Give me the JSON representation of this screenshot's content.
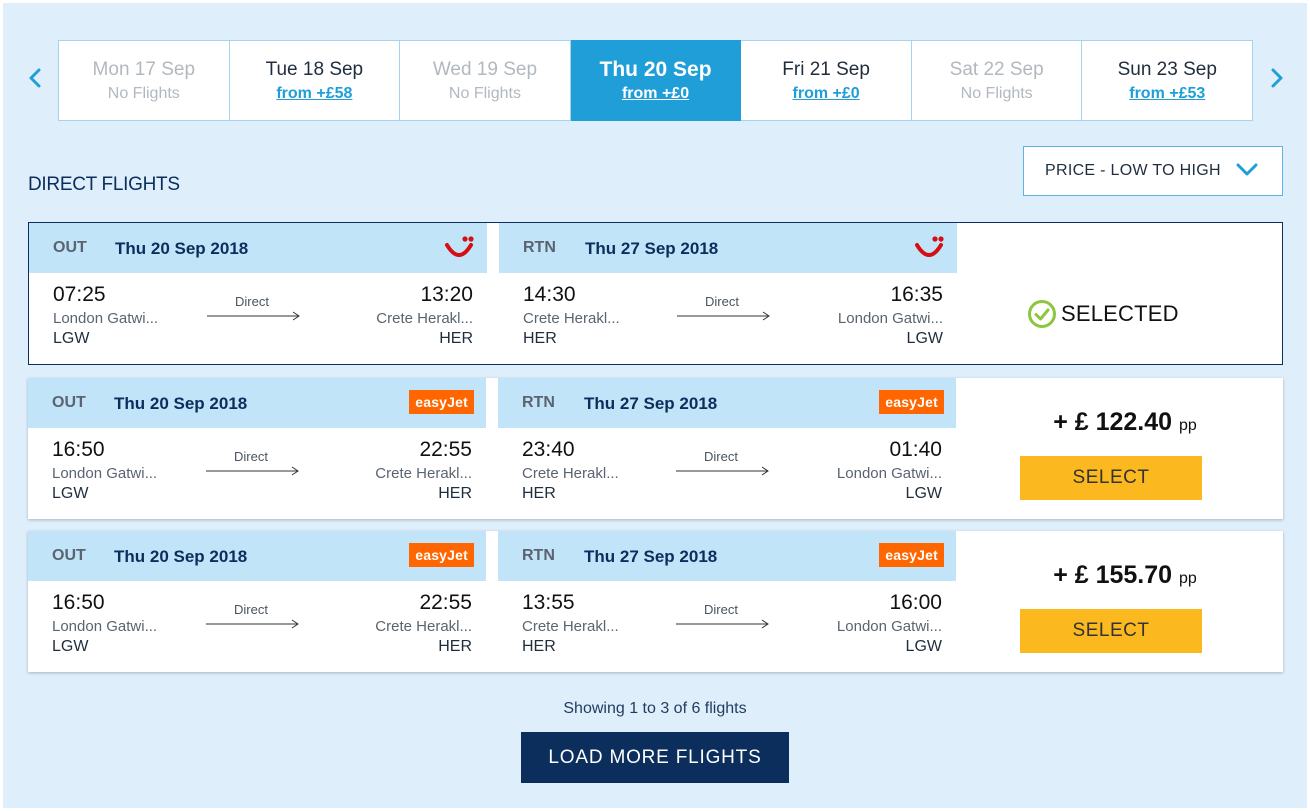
{
  "dates": [
    {
      "day": "Mon 17 Sep",
      "sub": "No Flights",
      "state": "disabled"
    },
    {
      "day": "Tue 18 Sep",
      "sub": "from +£58",
      "state": "available"
    },
    {
      "day": "Wed 19 Sep",
      "sub": "No Flights",
      "state": "disabled"
    },
    {
      "day": "Thu 20 Sep",
      "sub": "from +£0",
      "state": "active"
    },
    {
      "day": "Fri 21 Sep",
      "sub": "from +£0",
      "state": "available"
    },
    {
      "day": "Sat 22 Sep",
      "sub": "No Flights",
      "state": "disabled"
    },
    {
      "day": "Sun 23 Sep",
      "sub": "from +£53",
      "state": "available"
    }
  ],
  "heading": "DIRECT FLIGHTS",
  "sort": {
    "label": "PRICE - LOW TO HIGH"
  },
  "flights": [
    {
      "out": {
        "kind": "OUT",
        "date": "Thu 20 Sep 2018",
        "airline": "TUI",
        "dep_time": "07:25",
        "dep_city": "London Gatwi...",
        "dep_code": "LGW",
        "stop": "Direct",
        "arr_time": "13:20",
        "arr_city": "Crete Herakl...",
        "arr_code": "HER"
      },
      "rtn": {
        "kind": "RTN",
        "date": "Thu 27 Sep 2018",
        "airline": "TUI",
        "dep_time": "14:30",
        "dep_city": "Crete Herakl...",
        "dep_code": "HER",
        "stop": "Direct",
        "arr_time": "16:35",
        "arr_city": "London Gatwi...",
        "arr_code": "LGW"
      },
      "status": "SELECTED"
    },
    {
      "out": {
        "kind": "OUT",
        "date": "Thu 20 Sep 2018",
        "airline": "easyJet",
        "dep_time": "16:50",
        "dep_city": "London Gatwi...",
        "dep_code": "LGW",
        "stop": "Direct",
        "arr_time": "22:55",
        "arr_city": "Crete Herakl...",
        "arr_code": "HER"
      },
      "rtn": {
        "kind": "RTN",
        "date": "Thu 27 Sep 2018",
        "airline": "easyJet",
        "dep_time": "23:40",
        "dep_city": "Crete Herakl...",
        "dep_code": "HER",
        "stop": "Direct",
        "arr_time": "01:40",
        "arr_city": "London Gatwi...",
        "arr_code": "LGW"
      },
      "price": "+ £ 122.40",
      "pp": "pp",
      "button": "SELECT"
    },
    {
      "out": {
        "kind": "OUT",
        "date": "Thu 20 Sep 2018",
        "airline": "easyJet",
        "dep_time": "16:50",
        "dep_city": "London Gatwi...",
        "dep_code": "LGW",
        "stop": "Direct",
        "arr_time": "22:55",
        "arr_city": "Crete Herakl...",
        "arr_code": "HER"
      },
      "rtn": {
        "kind": "RTN",
        "date": "Thu 27 Sep 2018",
        "airline": "easyJet",
        "dep_time": "13:55",
        "dep_city": "Crete Herakl...",
        "dep_code": "HER",
        "stop": "Direct",
        "arr_time": "16:00",
        "arr_city": "London Gatwi...",
        "arr_code": "LGW"
      },
      "price": "+ £ 155.70",
      "pp": "pp",
      "button": "SELECT"
    }
  ],
  "showing": "Showing 1 to 3 of 6 flights",
  "load_more": "LOAD MORE FLIGHTS",
  "colors": {
    "accent": "#1f9ed8",
    "navy": "#0b2e5c",
    "select": "#fcb81f",
    "easyjet": "#ff6600",
    "tui": "#d40e14",
    "check": "#8cc63f"
  }
}
